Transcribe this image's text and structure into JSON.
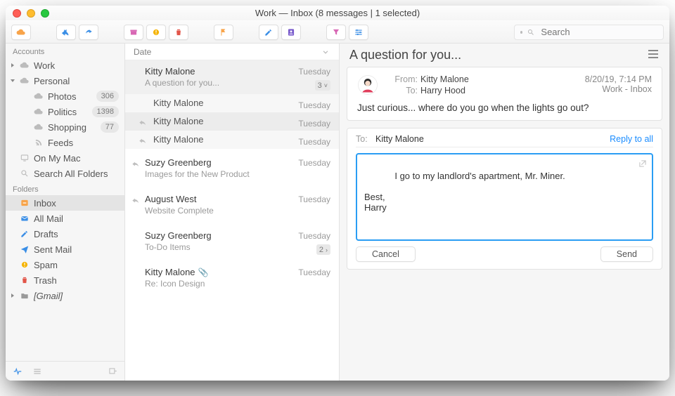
{
  "window": {
    "title": "Work — Inbox (8 messages | 1 selected)"
  },
  "toolbar": {
    "search_placeholder": "Search",
    "buttons": {
      "cloud": "cloud-icon",
      "reply_all": "reply-all-icon",
      "forward": "forward-icon",
      "archive": "archive-icon",
      "spam": "spam-icon",
      "trash": "trash-icon",
      "flag": "flag-icon",
      "compose": "compose-icon",
      "contact": "contact-icon",
      "funnel": "filter-icon",
      "settings": "prefs-icon"
    }
  },
  "sidebar": {
    "heading_accounts": "Accounts",
    "heading_folders": "Folders",
    "items_a": [
      {
        "label": "Work",
        "depth": 0,
        "icon": "cloud",
        "tri": "right"
      },
      {
        "label": "Personal",
        "depth": 0,
        "icon": "cloud",
        "tri": "down"
      },
      {
        "label": "Photos",
        "depth": 1,
        "icon": "cloud",
        "badge": "306"
      },
      {
        "label": "Politics",
        "depth": 1,
        "icon": "cloud",
        "badge": "1398"
      },
      {
        "label": "Shopping",
        "depth": 1,
        "icon": "cloud",
        "badge": "77"
      },
      {
        "label": "Feeds",
        "depth": 1,
        "icon": "rss"
      },
      {
        "label": "On My Mac",
        "depth": 0,
        "icon": "monitor"
      },
      {
        "label": "Search All Folders",
        "depth": 0,
        "icon": "search"
      }
    ],
    "items_f": [
      {
        "label": "Inbox",
        "icon": "inbox",
        "color": "orange",
        "selected": true
      },
      {
        "label": "All Mail",
        "icon": "allmail",
        "color": "blue"
      },
      {
        "label": "Drafts",
        "icon": "drafts",
        "color": "blue"
      },
      {
        "label": "Sent Mail",
        "icon": "sent",
        "color": "blue"
      },
      {
        "label": "Spam",
        "icon": "spam",
        "color": "yellow"
      },
      {
        "label": "Trash",
        "icon": "trash",
        "color": "red"
      },
      {
        "label": "[Gmail]",
        "icon": "folder",
        "color": "gray",
        "tri": "right",
        "italic": true
      }
    ]
  },
  "msglist": {
    "header": "Date",
    "threads": [
      {
        "selected": true,
        "main": {
          "sender": "Kitty Malone",
          "subject": "A question for you...",
          "date": "Tuesday",
          "badge": "3"
        },
        "children": [
          {
            "sender": "Kitty Malone",
            "date": "Tuesday",
            "reply": false
          },
          {
            "sender": "Kitty Malone",
            "date": "Tuesday",
            "reply": true,
            "active": true
          },
          {
            "sender": "Kitty Malone",
            "date": "Tuesday",
            "reply": true
          }
        ]
      },
      {
        "main": {
          "sender": "Suzy Greenberg",
          "subject": "Images for the New Product",
          "date": "Tuesday",
          "reply": true
        }
      },
      {
        "main": {
          "sender": "August West",
          "subject": "Website Complete",
          "date": "Tuesday",
          "reply": true
        }
      },
      {
        "main": {
          "sender": "Suzy Greenberg",
          "subject": "To-Do Items",
          "date": "Tuesday",
          "badge": "2"
        }
      },
      {
        "main": {
          "sender": "Kitty Malone",
          "subject": "Re: Icon Design",
          "date": "Tuesday",
          "attach": true
        }
      }
    ]
  },
  "reader": {
    "title": "A question for you...",
    "meta": {
      "from_label": "From:",
      "from_value": "Kitty Malone",
      "to_label": "To:",
      "to_value": "Harry Hood",
      "datetime": "8/20/19, 7:14 PM",
      "folder": "Work - Inbox"
    },
    "body": "Just curious... where do you go when the lights go out?"
  },
  "compose": {
    "to_label": "To:",
    "to_value": "Kitty Malone",
    "reply_all_label": "Reply to all",
    "body": "I go to my landlord's apartment, Mr. Miner.\n\nBest,\nHarry",
    "cancel": "Cancel",
    "send": "Send"
  }
}
